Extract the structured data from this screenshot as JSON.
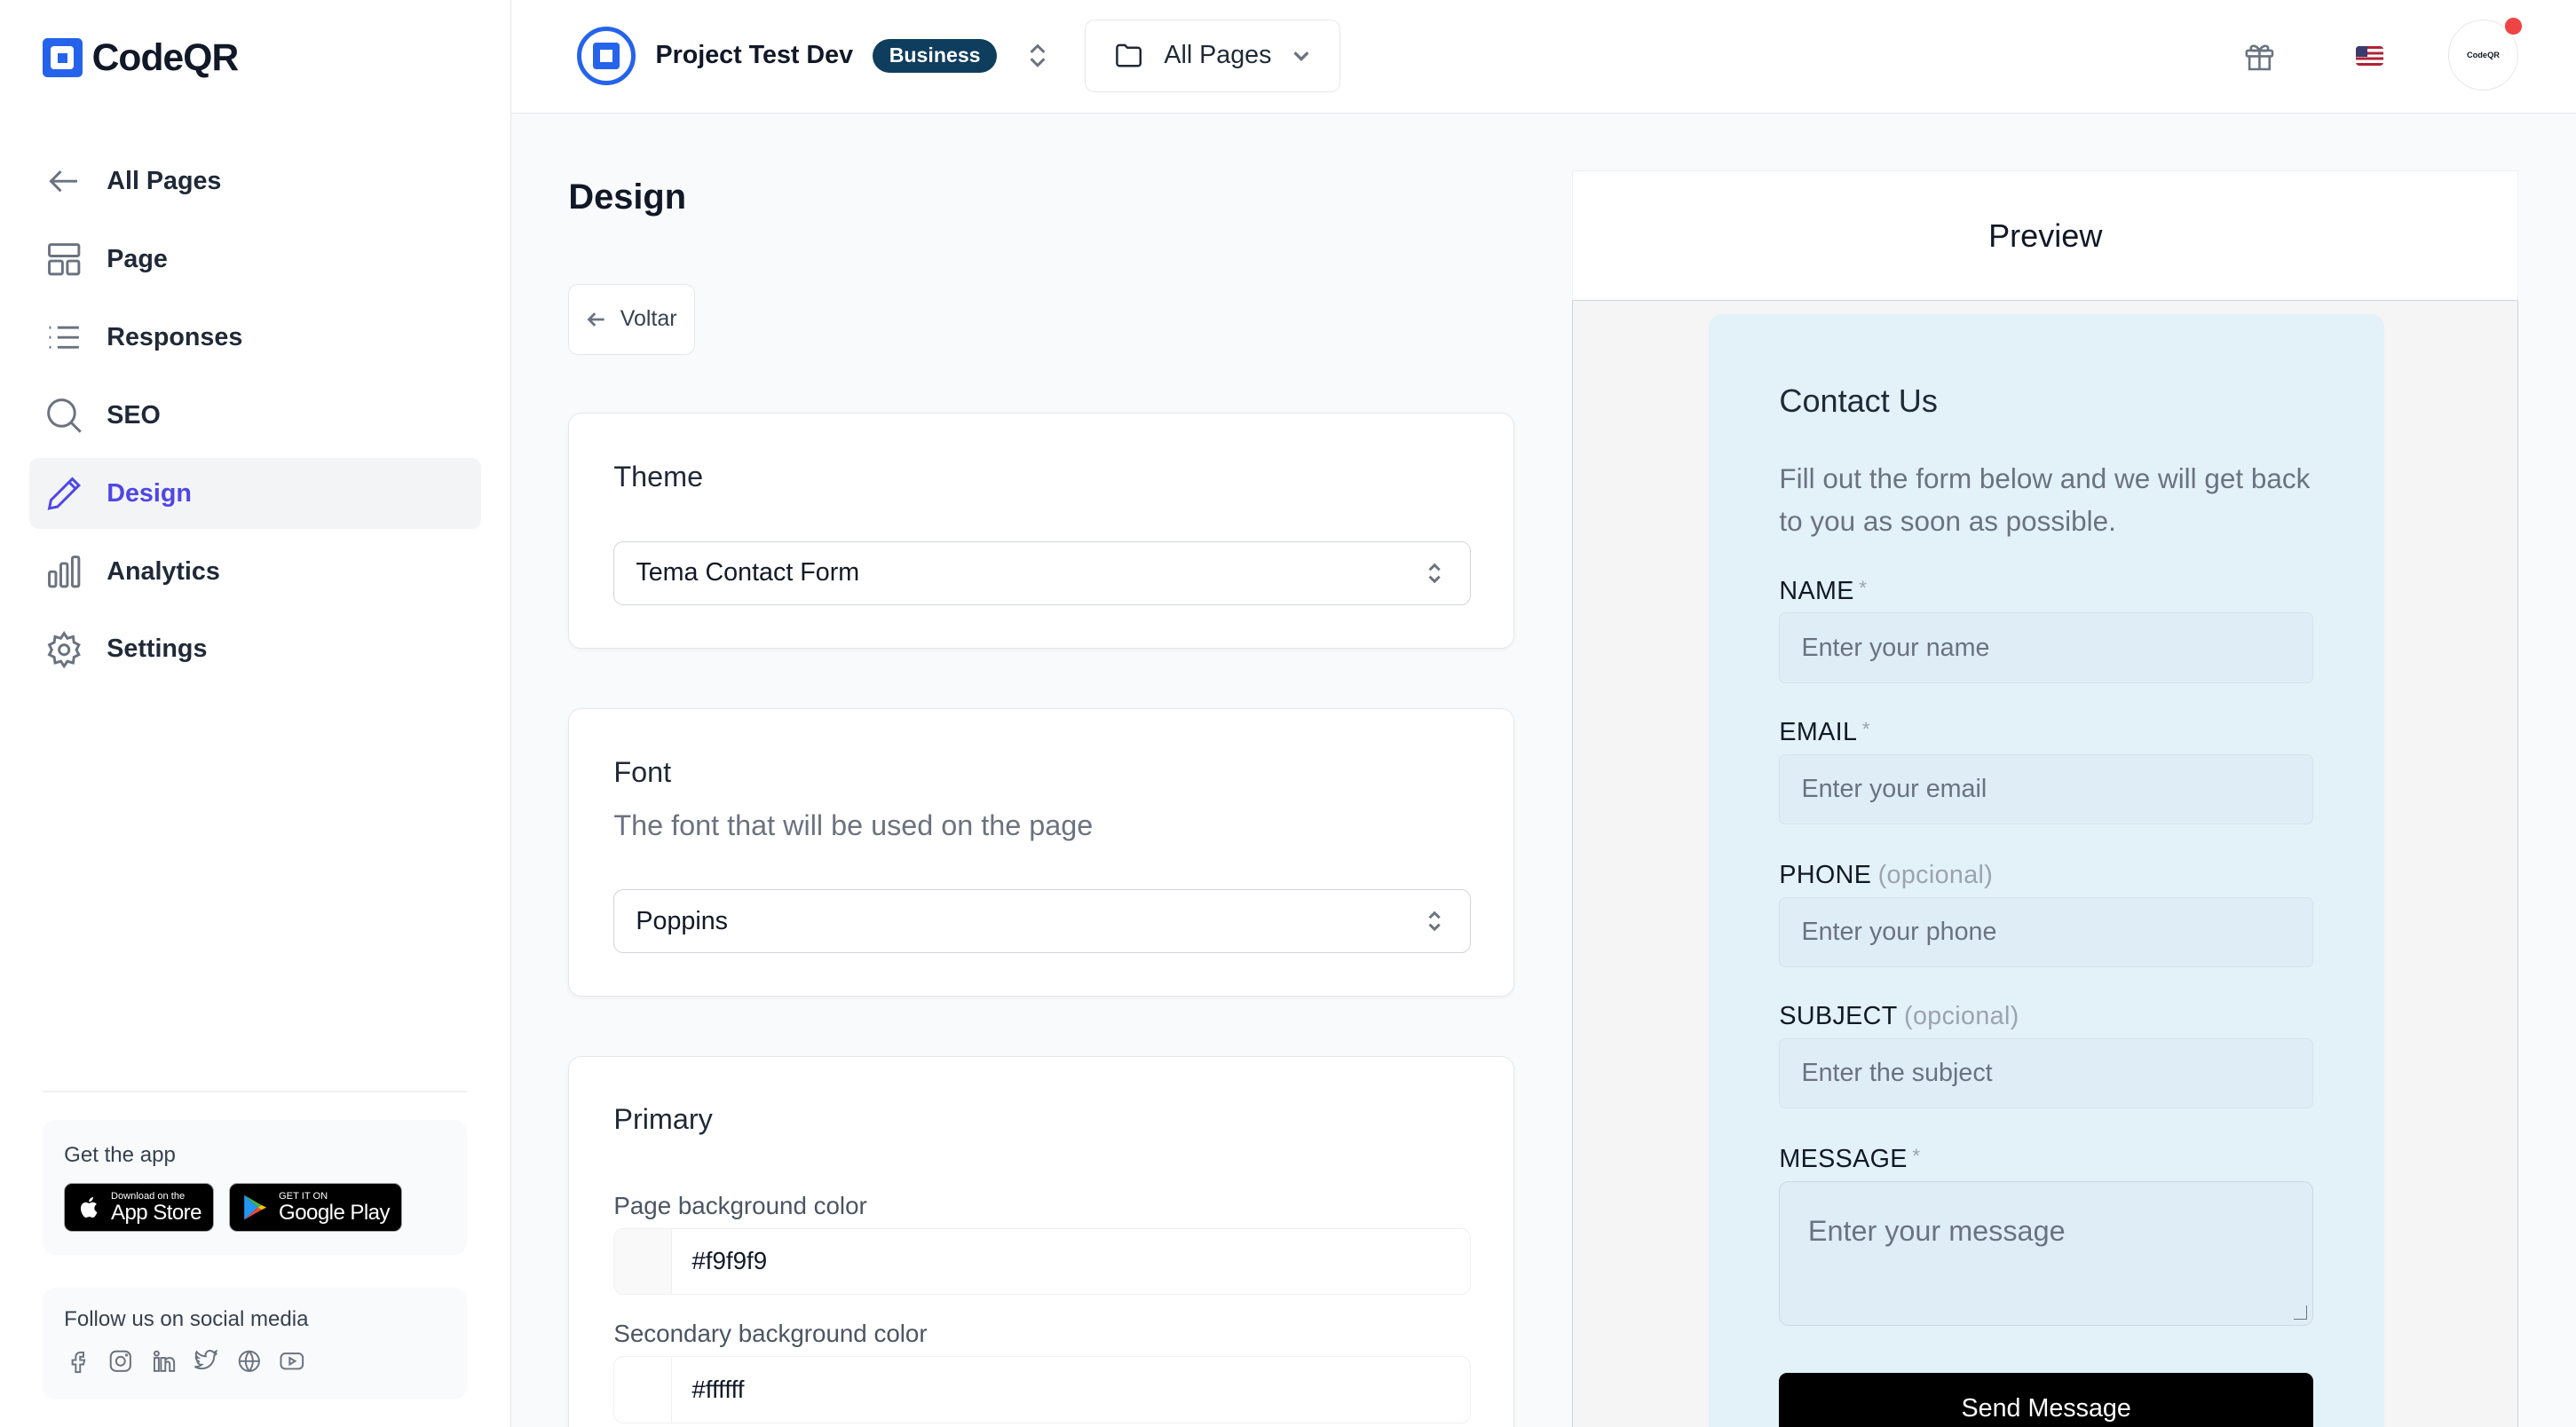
{
  "app": {
    "name": "CodeQR"
  },
  "sidebar": {
    "items": [
      {
        "label": "All Pages",
        "icon": "arrow-left-icon"
      },
      {
        "label": "Page",
        "icon": "layout-icon"
      },
      {
        "label": "Responses",
        "icon": "list-icon"
      },
      {
        "label": "SEO",
        "icon": "search-icon"
      },
      {
        "label": "Design",
        "icon": "pencil-icon",
        "active": true
      },
      {
        "label": "Analytics",
        "icon": "bar-chart-icon"
      },
      {
        "label": "Settings",
        "icon": "gear-icon"
      }
    ],
    "get_app": {
      "title": "Get the app",
      "app_store_small": "Download on the",
      "app_store_big": "App Store",
      "google_play_small": "GET IT ON",
      "google_play_big": "Google Play"
    },
    "social": {
      "title": "Follow us on social media",
      "icons": [
        "facebook-icon",
        "instagram-icon",
        "linkedin-icon",
        "twitter-icon",
        "globe-icon",
        "youtube-icon"
      ]
    }
  },
  "header": {
    "project_name": "Project Test Dev",
    "plan_badge": "Business",
    "pages_button": "All Pages",
    "avatar_text": "CodeQR",
    "accent": "#2563eb"
  },
  "main": {
    "title": "Design",
    "back_label": "Voltar",
    "theme": {
      "title": "Theme",
      "selected": "Tema Contact Form"
    },
    "font": {
      "title": "Font",
      "subtitle": "The font that will be used on the page",
      "selected": "Poppins"
    },
    "primary": {
      "title": "Primary",
      "page_bg_label": "Page background color",
      "page_bg_value": "#f9f9f9",
      "secondary_bg_label": "Secondary background color",
      "secondary_bg_value": "#ffffff"
    }
  },
  "preview": {
    "title": "Preview",
    "form": {
      "title": "Contact Us",
      "description": "Fill out the form below and we will get back to you as soon as possible.",
      "required_mark": "*",
      "optional_text": "(opcional)",
      "fields": {
        "name": {
          "label": "NAME",
          "placeholder": "Enter your name"
        },
        "email": {
          "label": "EMAIL",
          "placeholder": "Enter your email"
        },
        "phone": {
          "label": "PHONE",
          "placeholder": "Enter your phone"
        },
        "subject": {
          "label": "SUBJECT",
          "placeholder": "Enter the subject"
        },
        "message": {
          "label": "MESSAGE",
          "placeholder": "Enter your message"
        }
      },
      "submit": "Send Message"
    }
  }
}
